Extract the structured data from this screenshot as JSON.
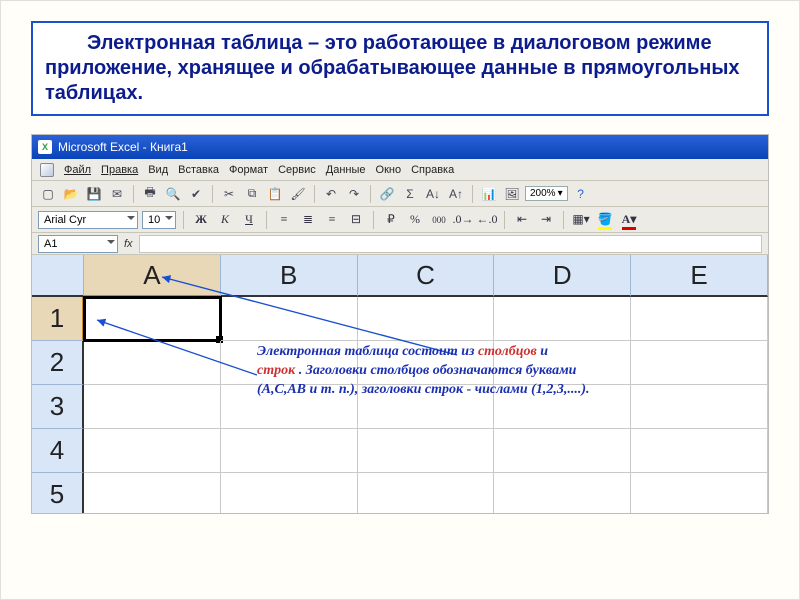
{
  "slide": {
    "definition": "Электронная таблица – это работающее в диалоговом режиме приложение, хранящее и обрабатывающее данные в прямоугольных таблицах."
  },
  "excel": {
    "title": "Microsoft Excel - Книга1",
    "menu": {
      "file": "Файл",
      "edit": "Правка",
      "view": "Вид",
      "insert": "Вставка",
      "format": "Формат",
      "tools": "Сервис",
      "data": "Данные",
      "window": "Окно",
      "help": "Справка"
    },
    "zoom": "200%",
    "font_name": "Arial Cyr",
    "font_size": "10",
    "namebox": "A1",
    "fx_label": "fx",
    "columns": [
      "A",
      "B",
      "C",
      "D",
      "E"
    ],
    "rows": [
      "1",
      "2",
      "3",
      "4",
      "5"
    ],
    "currency": "₽",
    "percent": "%",
    "digits": "000"
  },
  "annotation": {
    "line1_a": "Электронная таблица состоит из ",
    "line1_col": "столбцов",
    "line1_b": "  и",
    "line2_row": "строк",
    "line2_a": " . Заголовки столбцов обозначаются буквами",
    "line3": "(A,C,AB и т. п.), заголовки строк - числами (1,2,3,....)."
  }
}
